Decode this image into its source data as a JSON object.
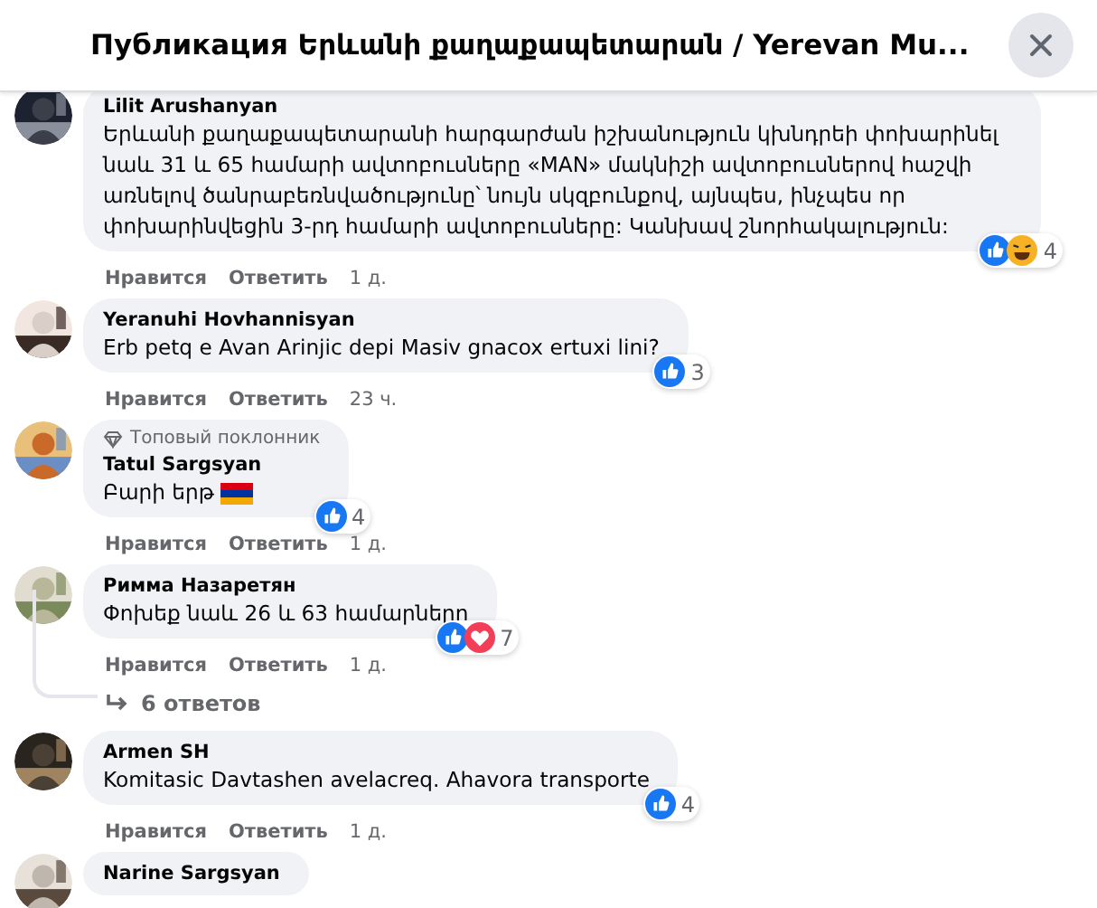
{
  "header": {
    "title": "Публикация Երևանի քաղաքապետարան / Yerevan Mu..."
  },
  "comments": [
    {
      "author": "Lilit Arushanyan",
      "text": "Երևանի քաղաքապետարանի հարգարժան իշխանություն կխնդրեի փոխարինել նաև 31 և 65 համարի ավտոբուսները «MAN» մակնիշի ավտոբուսներով հաշվի առնելով ծանրաբեռնվածությունը՝ նույն սկզբունքով, այնպես, ինչպես որ փոխարինվեցին 3-րդ համարի ավտոբուսները: Կանխավ շնորհակալություն:",
      "like": "Нравится",
      "reply": "Ответить",
      "time": "1 д.",
      "reactions": [
        {
          "kind": "like"
        },
        {
          "kind": "haha"
        }
      ],
      "count": "4"
    },
    {
      "author": "Yeranuhi Hovhannisyan",
      "text": "Erb petq e Avan Arinjic depi Masiv gnacox ertuxi lini?",
      "like": "Нравится",
      "reply": "Ответить",
      "time": "23 ч.",
      "reactions": [
        {
          "kind": "like"
        }
      ],
      "count": "3"
    },
    {
      "author": "Tatul Sargsyan",
      "badge": "Топовый поклонник",
      "text": "Բարի երթ",
      "flag": true,
      "like": "Нравится",
      "reply": "Ответить",
      "time": "1 д.",
      "reactions": [
        {
          "kind": "like"
        }
      ],
      "count": "4"
    },
    {
      "author": "Римма Назаретян",
      "text": "Փոխեք նաև 26 և 63 համարները",
      "like": "Нравится",
      "reply": "Ответить",
      "time": "1 д.",
      "reactions": [
        {
          "kind": "like"
        },
        {
          "kind": "love"
        }
      ],
      "count": "7",
      "replies": "6 ответов"
    },
    {
      "author": "Armen SH",
      "text": "Komitasic Davtashen avelacreq. Ahavora transporte",
      "like": "Нравится",
      "reply": "Ответить",
      "time": "1 д.",
      "reactions": [
        {
          "kind": "like"
        }
      ],
      "count": "4"
    },
    {
      "author": "Narine Sargsyan"
    }
  ]
}
